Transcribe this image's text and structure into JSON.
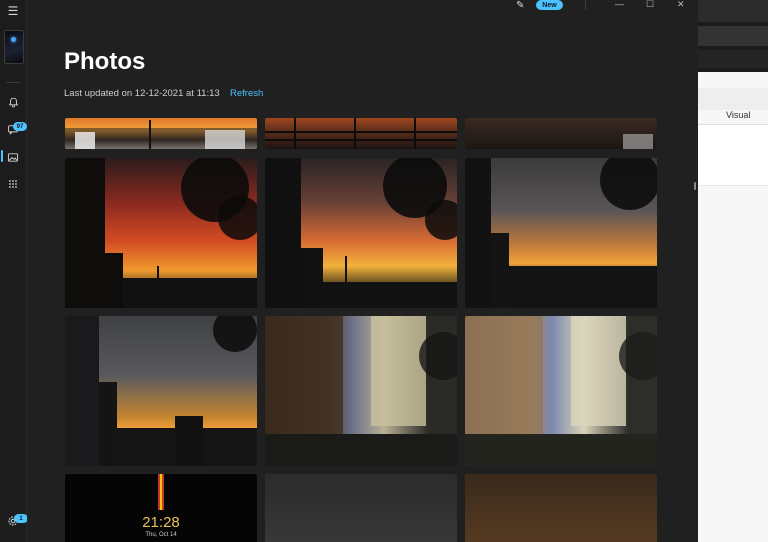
{
  "window": {
    "title": "Photos",
    "last_updated": "Last updated on 12-12-2021 at 11:13",
    "refresh_label": "Refresh",
    "new_badge": "New",
    "controls": {
      "minimize": "—",
      "maximize": "☐",
      "close": "✕"
    }
  },
  "sidebar": {
    "menu_icon": "☰",
    "notifications_icon": "🔔",
    "messages_badge": "97",
    "apps_icon": "⋮⋮",
    "settings_badge": "1"
  },
  "background_app": {
    "tab_label": "Visual"
  },
  "lockscreen_thumb": {
    "time": "21:28",
    "date": "Thu, Oct 14"
  },
  "colors": {
    "accent": "#4cc2ff",
    "window_bg": "#202020",
    "sidebar_bg": "#1c1c1c"
  }
}
